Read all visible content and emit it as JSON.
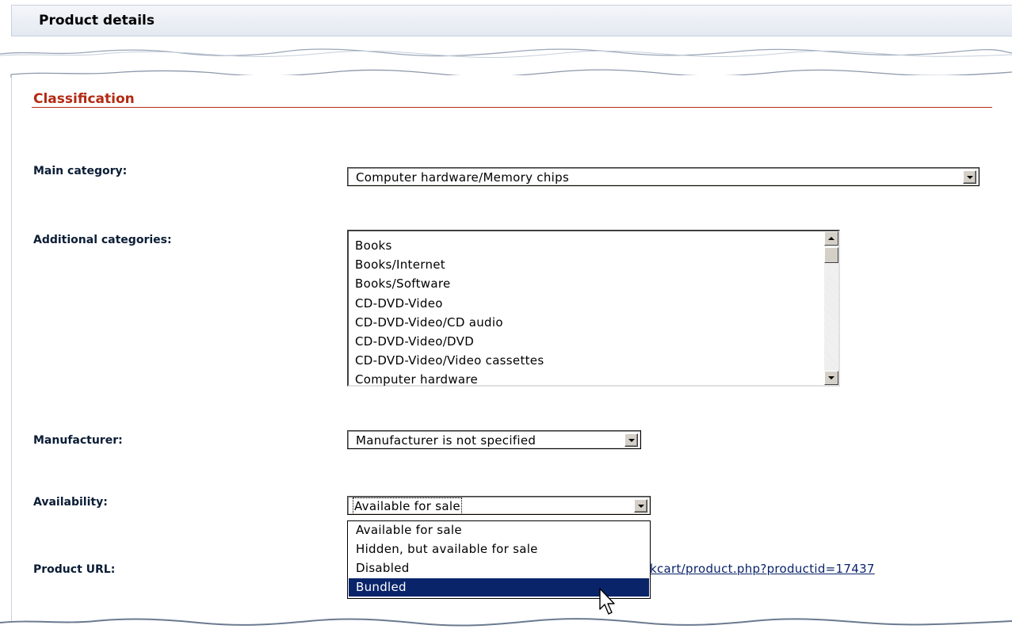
{
  "header": {
    "title": "Product details"
  },
  "section": {
    "title": "Classification"
  },
  "fields": {
    "main_category": {
      "label": "Main category:",
      "value": "Computer hardware/Memory chips"
    },
    "additional_categories": {
      "label": "Additional categories:",
      "items": [
        "Books",
        "Books/Internet",
        "Books/Software",
        "CD-DVD-Video",
        "CD-DVD-Video/CD audio",
        "CD-DVD-Video/DVD",
        "CD-DVD-Video/Video cassettes",
        "Computer hardware"
      ]
    },
    "manufacturer": {
      "label": "Manufacturer:",
      "value": "Manufacturer is not specified"
    },
    "availability": {
      "label": "Availability:",
      "value": "Available for sale",
      "options": [
        "Available for sale",
        "Hidden, but available for sale",
        "Disabled",
        "Bundled"
      ],
      "highlighted": "Bundled"
    },
    "product_url": {
      "label": "Product URL:",
      "value": "kcart/product.php?productid=17437"
    }
  },
  "colors": {
    "section_accent": "#b32a12",
    "selection": "#0a246a"
  },
  "icons": [
    "chevron-down-icon",
    "scroll-up-icon",
    "scroll-down-icon",
    "mouse-pointer-icon"
  ]
}
